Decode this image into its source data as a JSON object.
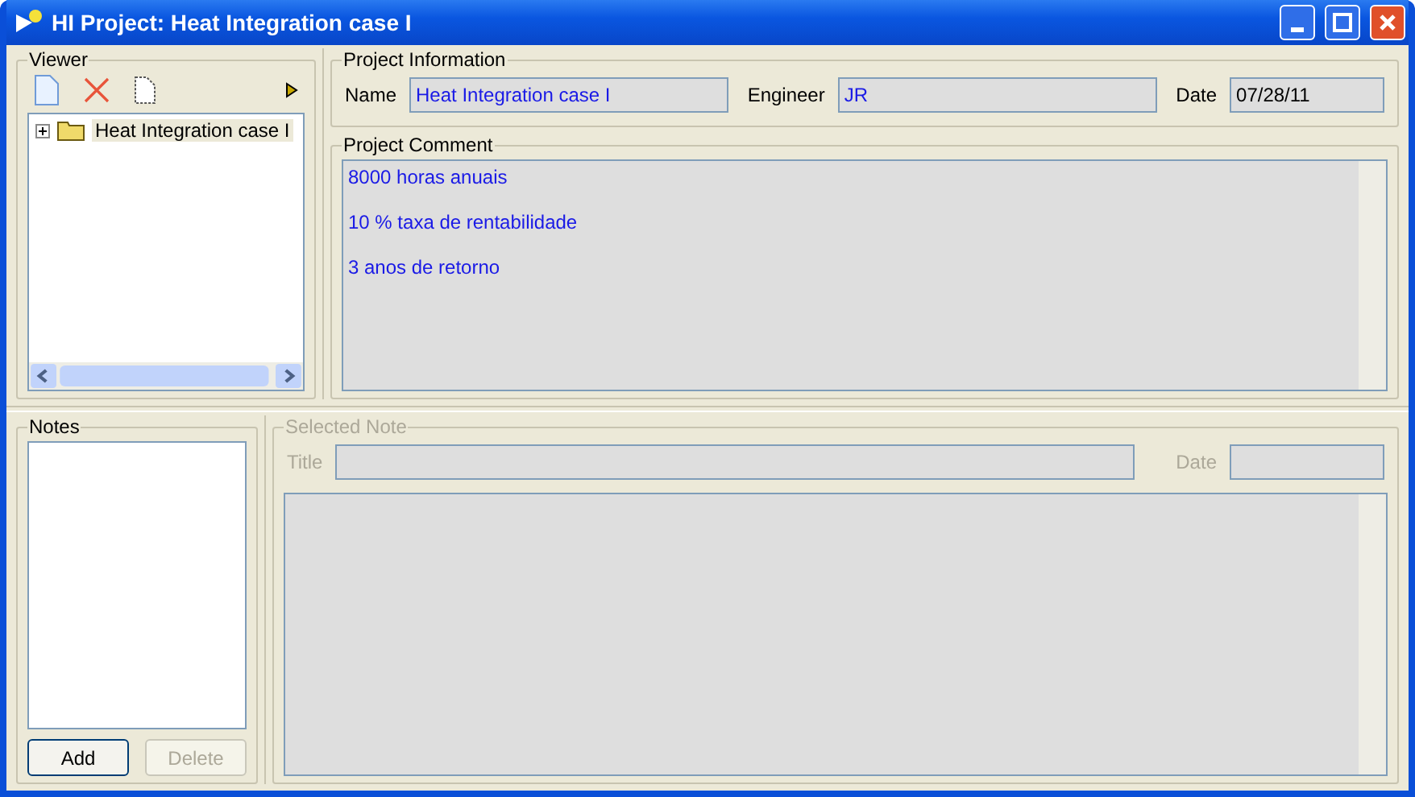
{
  "window": {
    "title": "HI Project:  Heat Integration case I"
  },
  "viewer": {
    "label": "Viewer",
    "tree": [
      {
        "label": "Heat Integration case I",
        "expanded": false
      }
    ]
  },
  "project_information": {
    "label": "Project Information",
    "fields": [
      {
        "label": "Name",
        "value": "Heat Integration case I",
        "kind": "text"
      },
      {
        "label": "Engineer",
        "value": "JR",
        "kind": "text"
      },
      {
        "label": "Date",
        "value": "07/28/11",
        "kind": "date"
      }
    ]
  },
  "project_comment": {
    "label": "Project Comment",
    "lines": [
      "8000 horas anuais",
      "10 % taxa de rentabilidade",
      "3 anos de retorno"
    ]
  },
  "notes": {
    "label": "Notes",
    "buttons": [
      {
        "label": "Add",
        "disabled": false
      },
      {
        "label": "Delete",
        "disabled": true
      }
    ]
  },
  "selected_note": {
    "label": "Selected Note",
    "disabled": true,
    "fields": [
      {
        "label": "Title"
      },
      {
        "label": "Date"
      }
    ]
  }
}
